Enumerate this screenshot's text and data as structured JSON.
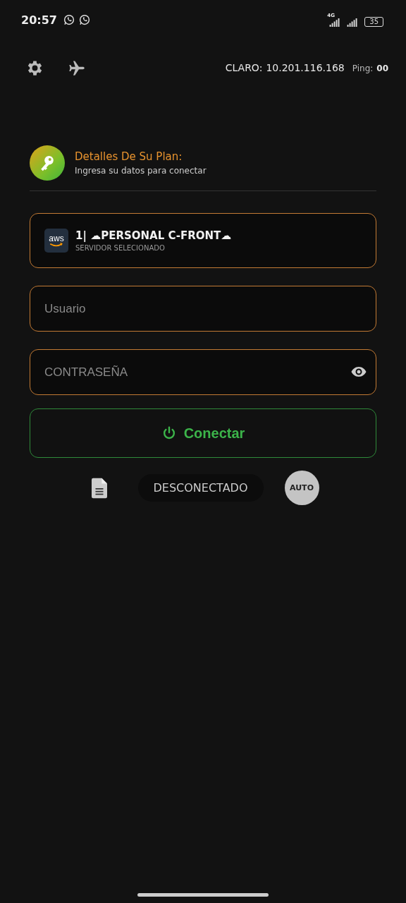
{
  "status_bar": {
    "time": "20:57",
    "network": "4G",
    "battery": "35"
  },
  "top_bar": {
    "carrier": "CLARO:",
    "ip": "10.201.116.168",
    "ping_label": "Ping:",
    "ping": "00"
  },
  "plan_header": {
    "title": "Detalles De Su Plan:",
    "subtitle": "Ingresa su datos para conectar"
  },
  "server": {
    "logo_text": "aws",
    "name": "1| ☁PERSONAL C-FRONT☁",
    "caption": "SERVIDOR SELECIONADO"
  },
  "fields": [
    {
      "kind": "text",
      "placeholder": "Usuario"
    },
    {
      "kind": "password",
      "placeholder": "CONTRASEÑA"
    }
  ],
  "connect_button": {
    "label": "Conectar"
  },
  "status": {
    "label": "DESCONECTADO"
  },
  "auto_button": {
    "label": "AUTO"
  }
}
